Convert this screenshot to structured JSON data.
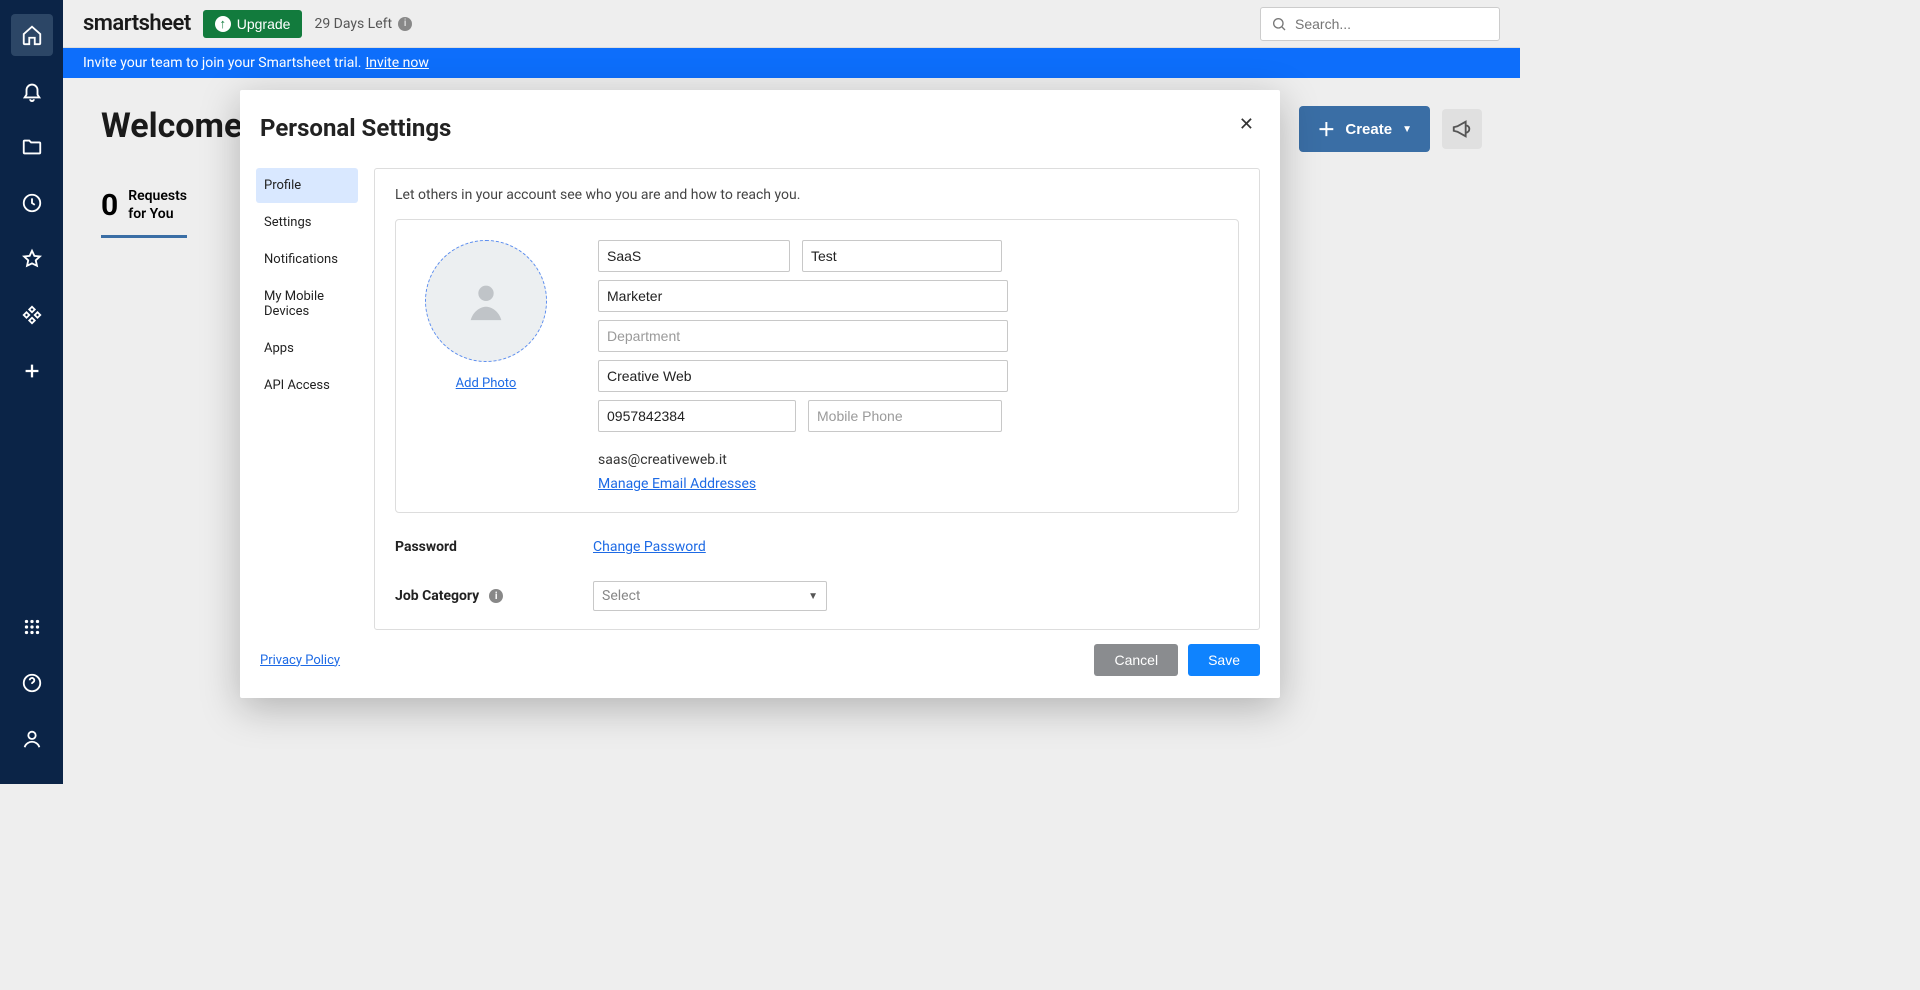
{
  "app": {
    "logo": "smartsheet"
  },
  "topbar": {
    "upgrade": "Upgrade",
    "trial": "29 Days Left",
    "search_placeholder": "Search..."
  },
  "banner": {
    "text": "Invite your team to join your Smartsheet trial.",
    "link": "Invite now"
  },
  "main": {
    "welcome": "Welcome",
    "create": "Create",
    "requests": {
      "count": "0",
      "line1": "Requests",
      "line2": "for You"
    }
  },
  "modal": {
    "title": "Personal Settings",
    "nav": {
      "profile": "Profile",
      "settings": "Settings",
      "notifications": "Notifications",
      "mobile": "My Mobile Devices",
      "apps": "Apps",
      "api": "API Access"
    },
    "panel": {
      "desc": "Let others in your account see who you are and how to reach you.",
      "add_photo": "Add Photo",
      "first_name": "SaaS",
      "last_name": "Test",
      "title": "Marketer",
      "department_placeholder": "Department",
      "company": "Creative Web",
      "work_phone": "0957842384",
      "mobile_placeholder": "Mobile Phone",
      "email": "saas@creativeweb.it",
      "manage_emails": "Manage Email Addresses",
      "password_label": "Password",
      "change_password": "Change Password",
      "job_label": "Job Category",
      "job_select": "Select"
    },
    "footer": {
      "privacy": "Privacy Policy",
      "cancel": "Cancel",
      "save": "Save"
    }
  }
}
